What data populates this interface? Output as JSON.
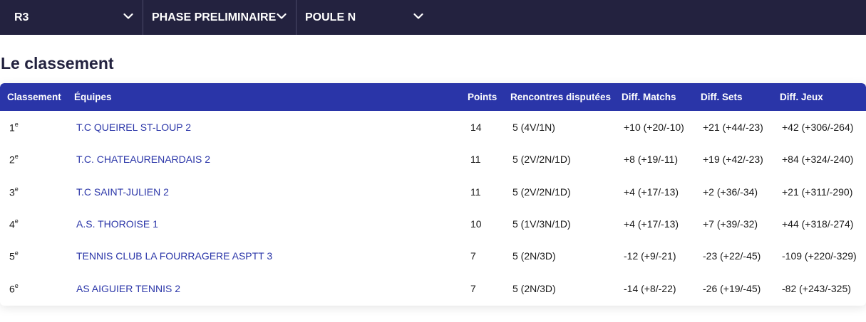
{
  "filters": {
    "division": "R3",
    "phase": "PHASE PRELIMINAIRE",
    "poule": "POULE N"
  },
  "title": "Le classement",
  "table": {
    "headers": {
      "rank": "Classement",
      "team": "Équipes",
      "points": "Points",
      "rencontres": "Rencontres disputées",
      "diff_matchs": "Diff. Matchs",
      "diff_sets": "Diff. Sets",
      "diff_jeux": "Diff. Jeux"
    },
    "rank_suffix": "e",
    "rows": [
      {
        "rank": "1",
        "team": "T.C QUEIREL ST-LOUP 2",
        "points": "14",
        "rencontres": "5 (4V/1N)",
        "diff_matchs": "+10 (+20/-10)",
        "diff_sets": "+21 (+44/-23)",
        "diff_jeux": "+42 (+306/-264)"
      },
      {
        "rank": "2",
        "team": "T.C. CHATEAURENARDAIS 2",
        "points": "11",
        "rencontres": "5 (2V/2N/1D)",
        "diff_matchs": "+8 (+19/-11)",
        "diff_sets": "+19 (+42/-23)",
        "diff_jeux": "+84 (+324/-240)"
      },
      {
        "rank": "3",
        "team": "T.C SAINT-JULIEN 2",
        "points": "11",
        "rencontres": "5 (2V/2N/1D)",
        "diff_matchs": "+4 (+17/-13)",
        "diff_sets": "+2 (+36/-34)",
        "diff_jeux": "+21 (+311/-290)"
      },
      {
        "rank": "4",
        "team": "A.S. THOROISE 1",
        "points": "10",
        "rencontres": "5 (1V/3N/1D)",
        "diff_matchs": "+4 (+17/-13)",
        "diff_sets": "+7 (+39/-32)",
        "diff_jeux": "+44 (+318/-274)"
      },
      {
        "rank": "5",
        "team": "TENNIS CLUB LA FOURRAGERE ASPTT 3",
        "points": "7",
        "rencontres": "5 (2N/3D)",
        "diff_matchs": "-12 (+9/-21)",
        "diff_sets": "-23 (+22/-45)",
        "diff_jeux": "-109 (+220/-329)"
      },
      {
        "rank": "6",
        "team": "AS AIGUIER TENNIS 2",
        "points": "7",
        "rencontres": "5 (2N/3D)",
        "diff_matchs": "-14 (+8/-22)",
        "diff_sets": "-26 (+19/-45)",
        "diff_jeux": "-82 (+243/-325)"
      }
    ]
  },
  "colors": {
    "filterbar": "#23223f",
    "table_header": "#2a35a8",
    "team_link": "#2a35a8",
    "title": "#23223f"
  }
}
